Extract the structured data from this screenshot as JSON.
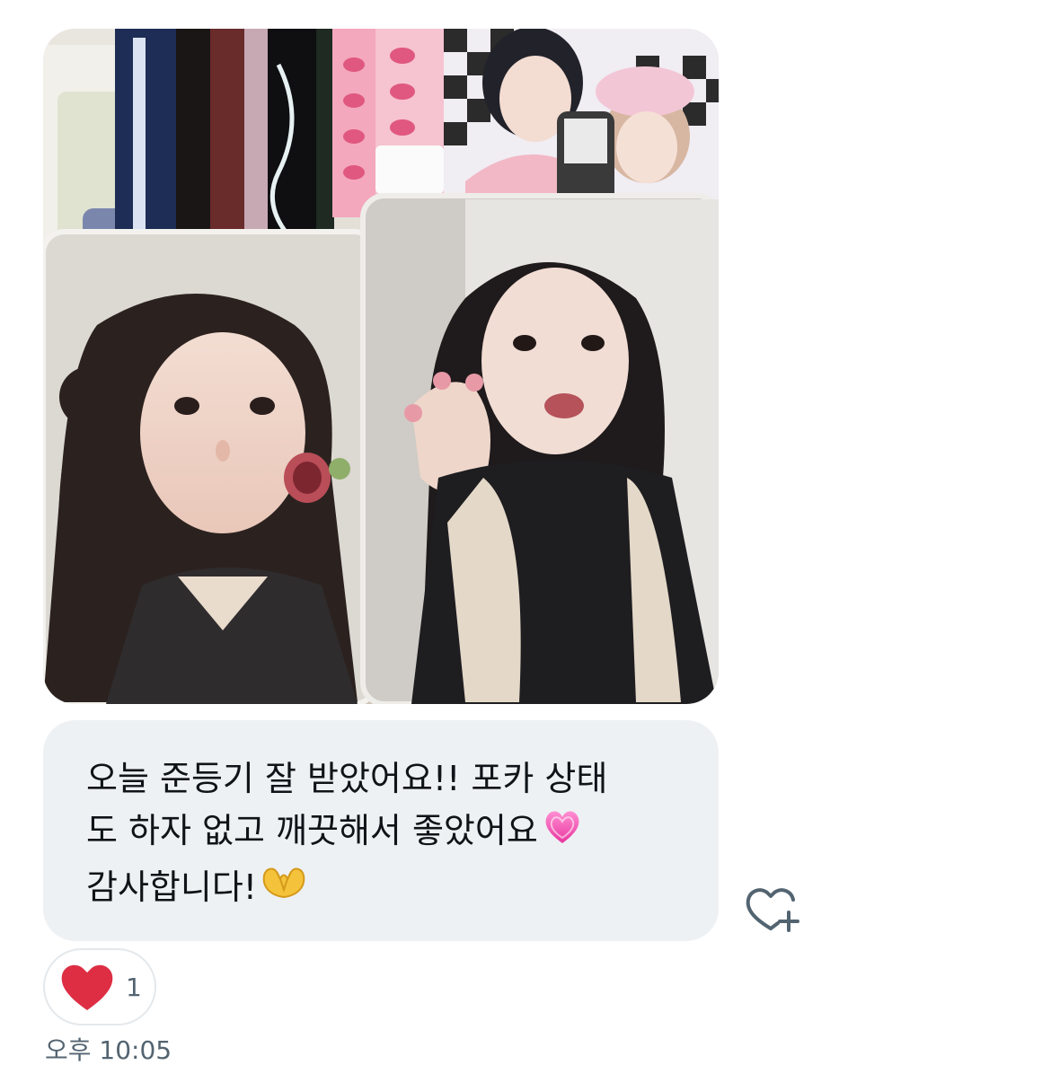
{
  "message": {
    "photo_alt": "photocards",
    "lines": [
      "오늘 준등기 잘 받았어요!! 포카 상태",
      "도 하자 없고 깨끗해서 좋았어요",
      "감사합니다!"
    ],
    "line2_emoji": "pink-heart-emoji",
    "line3_emoji": "heart-hands-emoji"
  },
  "reactions": {
    "emoji": "red-heart-emoji",
    "count": "1"
  },
  "add_reaction_icon": "heart-plus-icon",
  "timestamp": "오후 10:05",
  "colors": {
    "bubble_bg": "#eef1f4",
    "text": "#0f1419",
    "muted": "#536471",
    "heart_red": "#dd2e44"
  }
}
